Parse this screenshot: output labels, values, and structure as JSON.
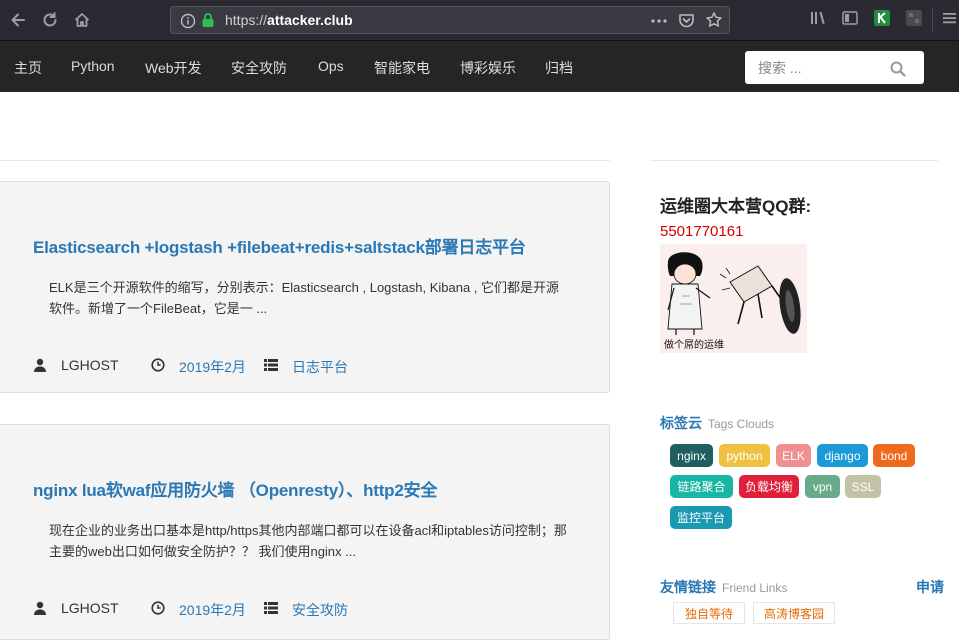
{
  "browser": {
    "url_prefix": "https://",
    "url_domain": "attacker.club",
    "icons": [
      "back-arrow-icon",
      "reload-icon",
      "home-icon",
      "info-icon",
      "lock-icon",
      "more-icon",
      "pocket-icon",
      "bookmark-star-icon",
      "library-icon",
      "sidebar-icon",
      "extension-icon",
      "extension-icon",
      "menu-icon"
    ]
  },
  "nav": {
    "items": [
      "主页",
      "Python",
      "Web开发",
      "安全攻防",
      "Ops",
      "智能家电",
      "博彩娱乐",
      "归档"
    ],
    "search_placeholder": "搜索 ..."
  },
  "posts": [
    {
      "title": "Elasticsearch +logstash +filebeat+redis+saltstack部署日志平台",
      "excerpt": "ELK是三个开源软件的缩写，分别表示：Elasticsearch , Logstash, Kibana , 它们都是开源软件。新增了一个FileBeat，它是一 ...",
      "author": "LGHOST",
      "date": "2019年2月",
      "category": "日志平台"
    },
    {
      "title": "nginx lua软waf应用防火墙 （Openresty）、http2安全",
      "excerpt": "现在企业的业务出口基本是http/https其他内部端口都可以在设备acl和iptables访问控制；那主要的web出口如何做安全防护？？ 我们使用nginx ...",
      "author": "LGHOST",
      "date": "2019年2月",
      "category": "安全攻防"
    }
  ],
  "sidebar": {
    "qq_title": "运维圈大本营QQ群:",
    "qq_number": "5501770161",
    "image_caption": "做个屌的运维",
    "tags_title": "标签云",
    "tags_subtitle": "Tags Clouds",
    "tags": [
      {
        "label": "nginx",
        "color": "#1f5f5f"
      },
      {
        "label": "python",
        "color": "#f0c040"
      },
      {
        "label": "ELK",
        "color": "#f08f8f"
      },
      {
        "label": "django",
        "color": "#1a9ad6"
      },
      {
        "label": "bond",
        "color": "#f06a1d"
      },
      {
        "label": "链路聚合",
        "color": "#19b5a5"
      },
      {
        "label": "负载均衡",
        "color": "#e0203a"
      },
      {
        "label": "vpn",
        "color": "#6aaa8a"
      },
      {
        "label": "SSL",
        "color": "#c2c2a4"
      },
      {
        "label": "监控平台",
        "color": "#1a9ab0"
      }
    ],
    "links_title": "友情链接",
    "links_subtitle": "Friend Links",
    "apply_label": "申请",
    "links": [
      "独自等待",
      "高涛博客园"
    ]
  }
}
